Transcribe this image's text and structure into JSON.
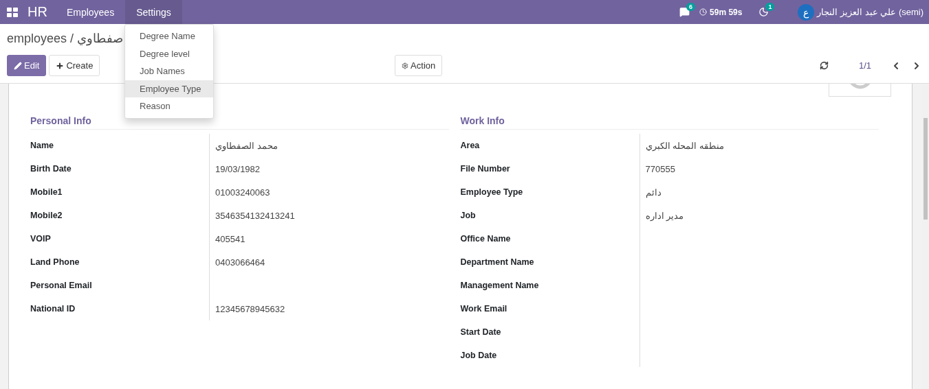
{
  "navbar": {
    "app": "HR",
    "menus": [
      {
        "label": "Employees",
        "selected": false
      },
      {
        "label": "Settings",
        "selected": true
      }
    ],
    "messages_count": "6",
    "timer": "59m 59s",
    "activity_count": "1",
    "user_initial": "ع",
    "user": "علي عبد العزيز النجار (semi)"
  },
  "dropdown": {
    "items": [
      {
        "label": "Degree Name",
        "selected": false
      },
      {
        "label": "Degree level",
        "selected": false
      },
      {
        "label": "Job Names",
        "selected": false
      },
      {
        "label": "Employee Type",
        "selected": true
      },
      {
        "label": "Reason",
        "selected": false
      }
    ]
  },
  "breadcrumb": "employees / صفطاوي",
  "buttons": {
    "edit": "Edit",
    "create": "Create",
    "action": "Action"
  },
  "pager": "1/1",
  "groups": [
    {
      "title": "Personal Info",
      "fields": [
        {
          "label": "Name",
          "value": "محمد الصفطاوي"
        },
        {
          "label": "Birth Date",
          "value": "19/03/1982"
        },
        {
          "label": "Mobile1",
          "value": "01003240063"
        },
        {
          "label": "Mobile2",
          "value": "3546354132413241"
        },
        {
          "label": "VOIP",
          "value": "405541"
        },
        {
          "label": "Land Phone",
          "value": "0403066464"
        },
        {
          "label": "Personal Email"
        },
        {
          "label": "National ID",
          "value": "12345678945632"
        }
      ]
    },
    {
      "title": "Work Info",
      "fields": [
        {
          "label": "Area",
          "value": "منطقه المحله الكبري"
        },
        {
          "label": "File Number",
          "value": "770555"
        },
        {
          "label": "Employee Type",
          "value": "دائم"
        },
        {
          "label": "Job",
          "value": "مدير اداره"
        },
        {
          "label": "Office Name"
        },
        {
          "label": "Department Name"
        },
        {
          "label": "Management Name"
        },
        {
          "label": "Work Email"
        },
        {
          "label": "Start Date"
        },
        {
          "label": "Job Date"
        }
      ]
    }
  ]
}
